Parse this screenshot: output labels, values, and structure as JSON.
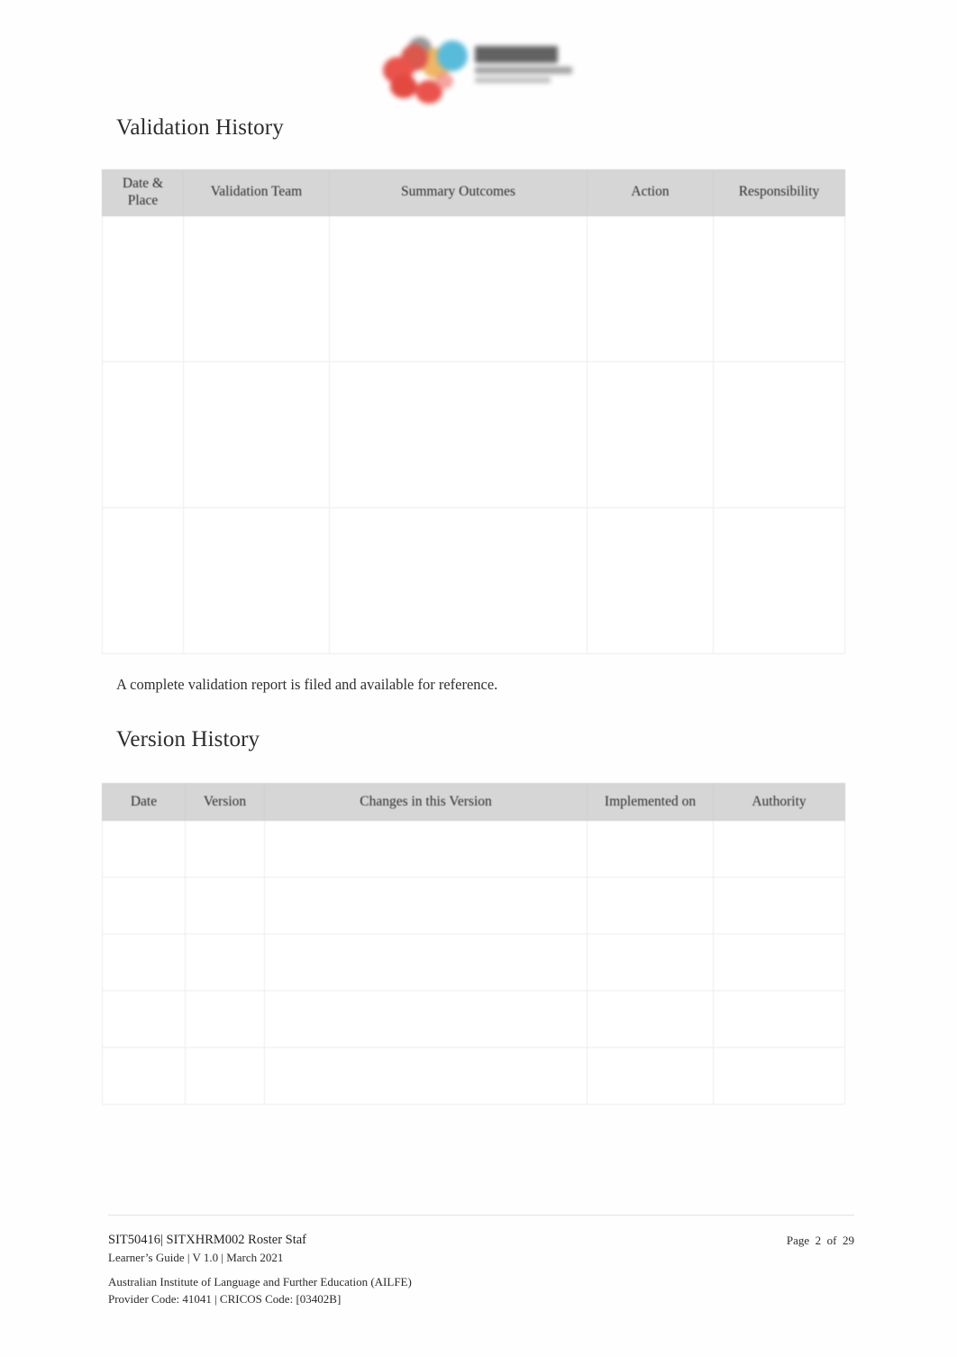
{
  "document": {
    "logo": {
      "icon_name": "ailfe-logo",
      "alt": "AILFE logo"
    },
    "sections": [
      {
        "heading": "Validation History",
        "note": "A complete validation report is filed and available for reference."
      },
      {
        "heading": "Version History"
      }
    ]
  },
  "validation_table": {
    "name": "validation-history-table",
    "columns": [
      "Date & Place",
      "Validation Team",
      "Summary Outcomes",
      "Action",
      "Responsibility"
    ],
    "rows": [
      [
        "",
        "",
        "",
        "",
        ""
      ],
      [
        "",
        "",
        "",
        "",
        ""
      ],
      [
        "",
        "",
        "",
        "",
        ""
      ]
    ]
  },
  "version_table": {
    "name": "version-history-table",
    "columns": [
      "Date",
      "Version",
      "Changes in this Version",
      "Implemented on",
      "Authority"
    ],
    "rows": [
      [
        "",
        "",
        "",
        "",
        ""
      ],
      [
        "",
        "",
        "",
        "",
        ""
      ],
      [
        "",
        "",
        "",
        "",
        ""
      ],
      [
        "",
        "",
        "",
        "",
        ""
      ],
      [
        "",
        "",
        "",
        "",
        ""
      ]
    ]
  },
  "footer": {
    "unit_code": "SIT50416| SITXHRM002 Roster Staf",
    "guide_line": "Learner’s Guide | V 1.0 | March 2021",
    "page_label": "Page  2  of  29",
    "organisation": "Australian Institute of Language and Further Education (AILFE)",
    "provider_codes": "Provider Code: 41041 | CRICOS Code: [03402B]"
  },
  "colors": {
    "table_header_bg": "#d6d6d6",
    "table_border": "#ededed",
    "text": "#2b2b2b",
    "page_bg": "#ffffff"
  }
}
